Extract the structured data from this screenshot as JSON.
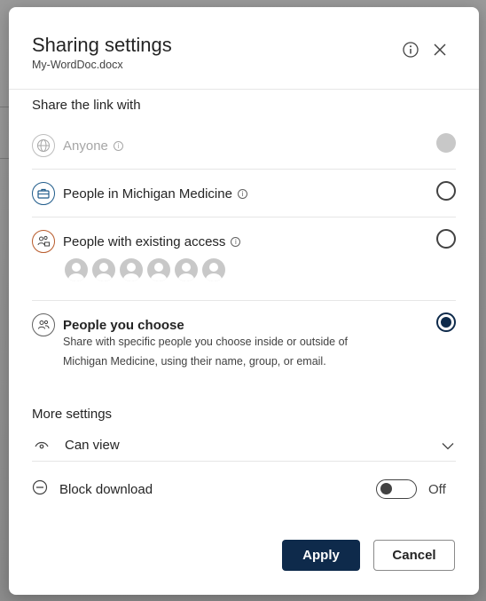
{
  "dialog": {
    "title": "Sharing settings",
    "filename": "My-WordDoc.docx",
    "info_icon": "info-icon",
    "close_icon": "close-icon"
  },
  "share_link": {
    "section_label": "Share the link with",
    "options": [
      {
        "label": "Anyone",
        "icon": "globe-icon",
        "state": "disabled",
        "has_info": true
      },
      {
        "label": "People in Michigan Medicine",
        "icon": "briefcase-icon",
        "state": "unselected",
        "has_info": true
      },
      {
        "label": "People with existing access",
        "icon": "people-lock-icon",
        "state": "unselected",
        "has_info": true,
        "avatar_count": 6
      },
      {
        "label": "People you choose",
        "icon": "people-icon",
        "state": "selected",
        "has_info": false,
        "description_line1": "Share with specific people you choose inside or outside of",
        "description_line2": "Michigan Medicine, using their name, group, or email."
      }
    ]
  },
  "more_settings": {
    "section_label": "More settings",
    "permission": {
      "value": "Can view",
      "icon": "eye-icon",
      "chevron": "chevron-down-icon"
    },
    "block_download": {
      "label": "Block download",
      "icon": "block-icon",
      "toggle_state": "Off"
    }
  },
  "actions": {
    "apply_label": "Apply",
    "cancel_label": "Cancel"
  },
  "colors": {
    "primary": "#0e2a4b",
    "michigan_icon": "#1f5b8a",
    "existing_access_icon": "#b85a2a"
  }
}
